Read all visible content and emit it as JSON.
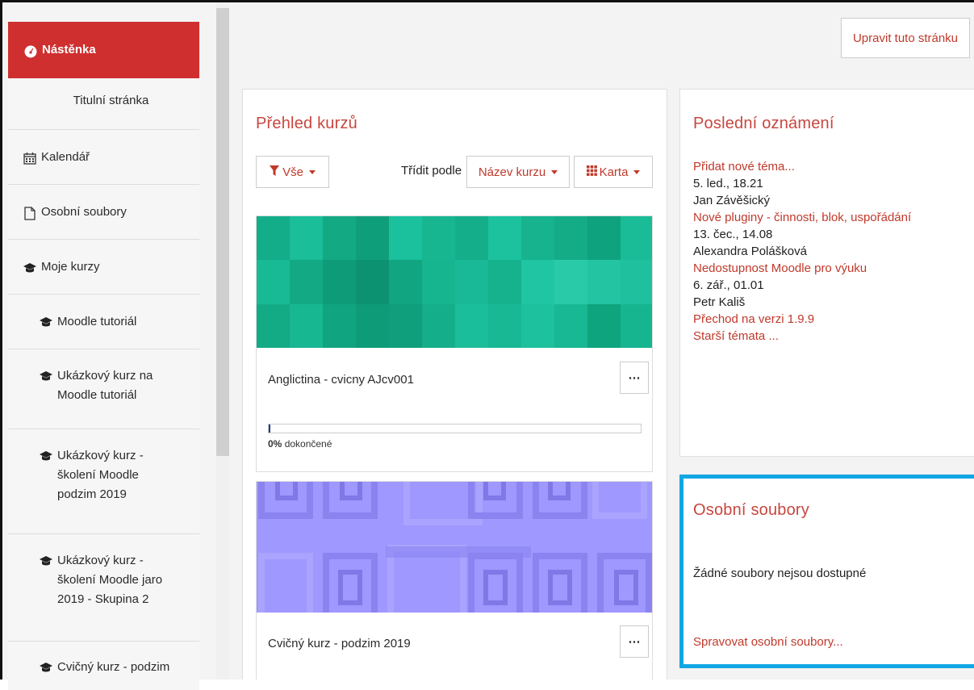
{
  "sidebar": {
    "items": [
      {
        "label": "Nástěnka",
        "icon": "dashboard-icon"
      },
      {
        "label": "Titulní stránka"
      },
      {
        "label": "Kalendář",
        "icon": "calendar-icon"
      },
      {
        "label": "Osobní soubory",
        "icon": "file-icon"
      },
      {
        "label": "Moje kurzy",
        "icon": "graduation-cap-icon"
      },
      {
        "label": "Moodle tutoriál",
        "icon": "graduation-cap-icon"
      },
      {
        "label": "Ukázkový kurz na",
        "label2": "Moodle tutoriál",
        "icon": "graduation-cap-icon"
      },
      {
        "label": "Ukázkový kurz -",
        "label2": "školení Moodle",
        "label3": "podzim 2019",
        "icon": "graduation-cap-icon"
      },
      {
        "label": "Ukázkový kurz -",
        "label2": "školení Moodle jaro",
        "label3": "2019 - Skupina 2",
        "icon": "graduation-cap-icon"
      },
      {
        "label": "Cvičný kurz - podzim",
        "icon": "graduation-cap-icon"
      }
    ]
  },
  "header": {
    "edit_button": "Upravit tuto stránku"
  },
  "course_overview": {
    "title": "Přehled kurzů",
    "filter_label": "Vše",
    "sort_label": "Třídit podle",
    "sort_value": "Název kurzu",
    "view_value": "Karta",
    "courses": [
      {
        "name": "Anglictina - cvicny AJcv001",
        "progress_percent": 0,
        "progress_value": "0%",
        "progress_text": "dokončené",
        "menu": "⋯"
      },
      {
        "name": "Cvičný kurz - podzim 2019",
        "menu": "⋯"
      }
    ]
  },
  "announcements": {
    "title": "Poslední oznámení",
    "items": [
      {
        "title": "Přidat nové téma...",
        "date": "5. led., 18.21",
        "author": "Jan Závěšický"
      },
      {
        "title": "Nové pluginy - činnosti, blok, uspořádání",
        "date": "13. čec., 14.08",
        "author": "Alexandra Polášková"
      },
      {
        "title": "Nedostupnost Moodle pro výuku",
        "date": "6. zář., 01.01",
        "author": "Petr Kališ"
      },
      {
        "title": "Přechod na verzi 1.9.9"
      }
    ],
    "older": "Starší témata ..."
  },
  "private_files": {
    "title": "Osobní soubory",
    "empty_text": "Žádné soubory nejsou dostupné",
    "manage_link": "Spravovat osobní soubory..."
  },
  "colors": {
    "accent": "#cf2f2f",
    "link": "#c0392b",
    "highlight_border": "#12a7e4"
  }
}
